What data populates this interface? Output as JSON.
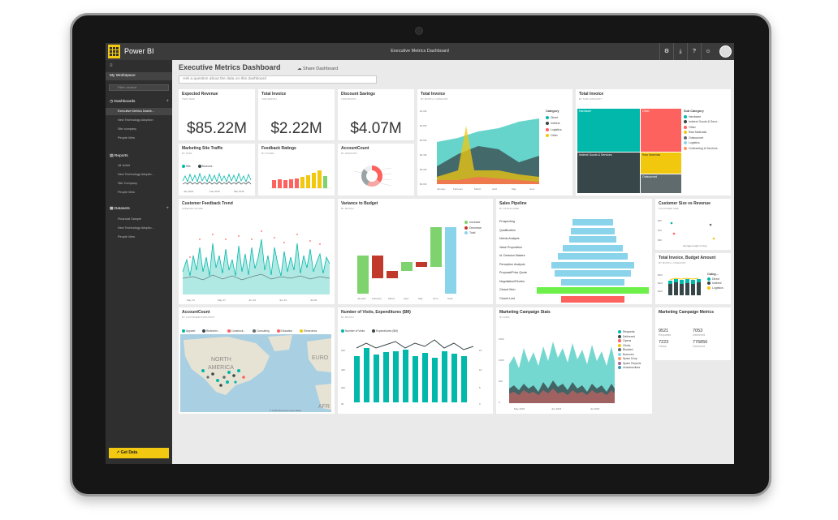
{
  "app": {
    "brand": "Power BI",
    "window_title": "Executive Metrics Dashboard",
    "toolbar_icons": [
      "gear-icon",
      "download-icon",
      "help-icon",
      "smiley-icon"
    ]
  },
  "sidebar": {
    "workspace": "My Workspace",
    "filter_placeholder": "Filter content",
    "sections": {
      "dashboards": {
        "label": "Dashboards",
        "items": [
          "Executive Metrics Dashb...",
          "New Technology Adoption",
          "Site company",
          "People View"
        ]
      },
      "reports": {
        "label": "Reports",
        "items": [
          "18 Juillet",
          "New Technology Adoptio...",
          "Site Company",
          "People View"
        ]
      },
      "datasets": {
        "label": "Datasets",
        "items": [
          "Financial Sample",
          "New Technology Adoptio...",
          "People View"
        ]
      }
    },
    "get_data": "Get Data"
  },
  "header": {
    "title": "Executive Metrics Dashboard",
    "share": "Share Dashboard",
    "qa_placeholder": "Ask a question about the data on this dashboard"
  },
  "tiles": {
    "expected_revenue": {
      "title": "Expected Revenue",
      "subtitle": "This year",
      "value": "$85.22M"
    },
    "total_invoice_kpi": {
      "title": "Total Invoice",
      "subtitle": "This month",
      "value": "$2.22M"
    },
    "discount_savings": {
      "title": "Discount Savings",
      "subtitle": "This month",
      "value": "$4.07M"
    },
    "total_invoice_area": {
      "title": "Total Invoice",
      "subtitle": "By month, category",
      "legend_title": "Category",
      "legend": [
        "Direct",
        "Indirect",
        "Logistics",
        "Other"
      ],
      "y_ticks": [
        "$1.0M",
        "$0.8M",
        "$0.6M",
        "$0.4M",
        "$0.2M",
        "$0.0M"
      ],
      "x_ticks": [
        "January",
        "February",
        "March",
        "April",
        "May",
        "June"
      ]
    },
    "total_invoice_treemap": {
      "title": "Total Invoice",
      "subtitle": "By sub category",
      "cells": [
        "Hardware",
        "Other",
        "Indirect Goods & Services",
        "Raw Materials",
        "Outsourced"
      ],
      "legend_title": "Sub Category",
      "legend": [
        "Hardware",
        "Indirect Goods & Servi...",
        "Other",
        "Raw Materials",
        "Outsourced",
        "Logistics",
        "Contracting & Services"
      ]
    },
    "marketing_site_traffic": {
      "title": "Marketing Site Traffic",
      "subtitle": "By date",
      "legend": [
        "Hits",
        "Bounces"
      ],
      "x_ticks": [
        "Jan 2015",
        "Feb 2015",
        "Mar 2015"
      ]
    },
    "feedback_ratings": {
      "title": "Feedback Ratings",
      "subtitle": "By score"
    },
    "account_count_donut": {
      "title": "AccountCount",
      "subtitle": "By industry"
    },
    "customer_feedback_trend": {
      "title": "Customer Feedback Trend",
      "subtitle": "Average score",
      "x_ticks": [
        "May 13",
        "May 27",
        "Jun 10",
        "Jun 24",
        "Jul 08"
      ]
    },
    "variance_to_budget": {
      "title": "Variance to Budget",
      "subtitle": "By month",
      "legend": [
        "Increase",
        "Decrease",
        "Total"
      ],
      "x_ticks": [
        "January",
        "February",
        "March",
        "April",
        "May",
        "June",
        "Total"
      ]
    },
    "sales_pipeline": {
      "title": "Sales Pipeline",
      "subtitle": "By stage name",
      "stages": [
        "Prospecting",
        "Qualification",
        "Needs Analysis",
        "Value Proposition",
        "Id. Decision Makers",
        "Perception Analysis",
        "Proposal/Price Quote",
        "Negotiation/Review",
        "Closed Won",
        "Closed Lost"
      ]
    },
    "customer_size_vs_revenue": {
      "title": "Customer Size vs Revenue",
      "subtitle": "Customer Size",
      "x_label": "average length of stay",
      "y_ticks": [
        "$2K",
        "$1K",
        "$0K"
      ]
    },
    "total_invoice_budget": {
      "title": "Total Invoice, Budget Amount",
      "subtitle": "By month, category",
      "legend_title": "Categ...",
      "legend": [
        "Direct",
        "Indirect",
        "Logistics"
      ],
      "y_ticks": [
        "$6M",
        "$4M",
        "$2M"
      ]
    },
    "account_count_map": {
      "title": "AccountCount",
      "subtitle": "By customer's industry",
      "legend": [
        "Apparel",
        "Biotechnl...",
        "Constructi...",
        "Consulting",
        "Education",
        "Electronics"
      ],
      "map_labels": [
        "NORTH",
        "AMERICA",
        "EURO",
        "AFR"
      ],
      "attribution": "© 2015 Microsoft Corporation"
    },
    "visits_expenditures": {
      "title": "Number of Visits, Expenditures ($M)",
      "subtitle": "By month",
      "legend": [
        "Number of Visits",
        "Expenditures ($M)"
      ],
      "y_ticks": [
        "60K",
        "40K",
        "20K",
        "0K"
      ],
      "y2_ticks": [
        "15",
        "10",
        "5",
        "0"
      ]
    },
    "marketing_campaign_stats": {
      "title": "Marketing Campaign Stats",
      "subtitle": "By date",
      "legend": [
        "Requests",
        "Delivered",
        "Opens",
        "Clicks",
        "Blocked",
        "Bounces",
        "Spam Drop",
        "Spam Reports",
        "Unsubscribes"
      ],
      "y_ticks": [
        "1500",
        "1000",
        "500",
        "0"
      ],
      "x_ticks": [
        "May 2015",
        "Jun 2015",
        "Jul 2015"
      ]
    },
    "marketing_campaign_metrics": {
      "title": "Marketing Campaign Metrics",
      "metrics": [
        {
          "value": "9521",
          "label": "Requests"
        },
        {
          "value": "7053",
          "label": "Delivered"
        },
        {
          "value": "7223",
          "label": "Clicks"
        },
        {
          "value": "776856",
          "label": "Delivered"
        }
      ]
    }
  },
  "colors": {
    "teal": "#01b8aa",
    "dark": "#374649",
    "red": "#fd625e",
    "yellow": "#f2c80f",
    "gray": "#5f6b6d",
    "blue": "#8ad4eb",
    "green": "#7fd36e",
    "orange": "#fe9666"
  }
}
